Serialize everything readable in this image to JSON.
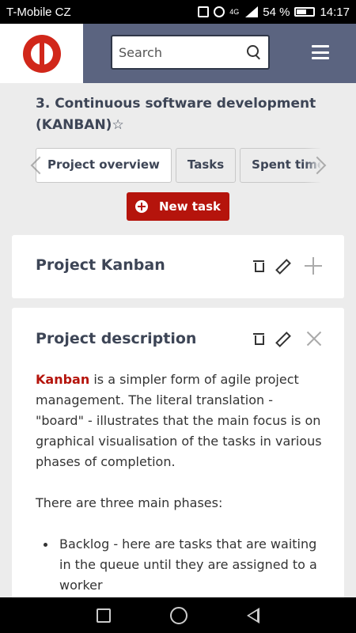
{
  "status_bar": {
    "carrier": "T-Mobile CZ",
    "network": "4G",
    "battery": "54 %",
    "time": "14:17"
  },
  "header": {
    "search_placeholder": "Search"
  },
  "project": {
    "title": "3. Continuous software development (KANBAN)",
    "star_icon": "☆"
  },
  "tabs": [
    {
      "label": "Project overview",
      "active": true
    },
    {
      "label": "Tasks",
      "active": false
    },
    {
      "label": "Spent time",
      "active": false
    }
  ],
  "new_task_label": "New task",
  "cards": {
    "kanban": {
      "title": "Project Kanban"
    },
    "description": {
      "title": "Project description",
      "kanban_word": "Kanban",
      "paragraph1_rest": " is a simpler form of agile project management. The literal translation - \"board\" - illustrates that the main focus is on graphical visualisation of the tasks in various phases of completion.",
      "paragraph2": "There are three main phases:",
      "bullets": [
        "Backlog - here are tasks that are waiting in the queue until they are assigned to a worker"
      ]
    }
  },
  "colors": {
    "brand_red": "#b5140c",
    "header_bg": "#5b6480",
    "text_dark": "#3d4556"
  }
}
